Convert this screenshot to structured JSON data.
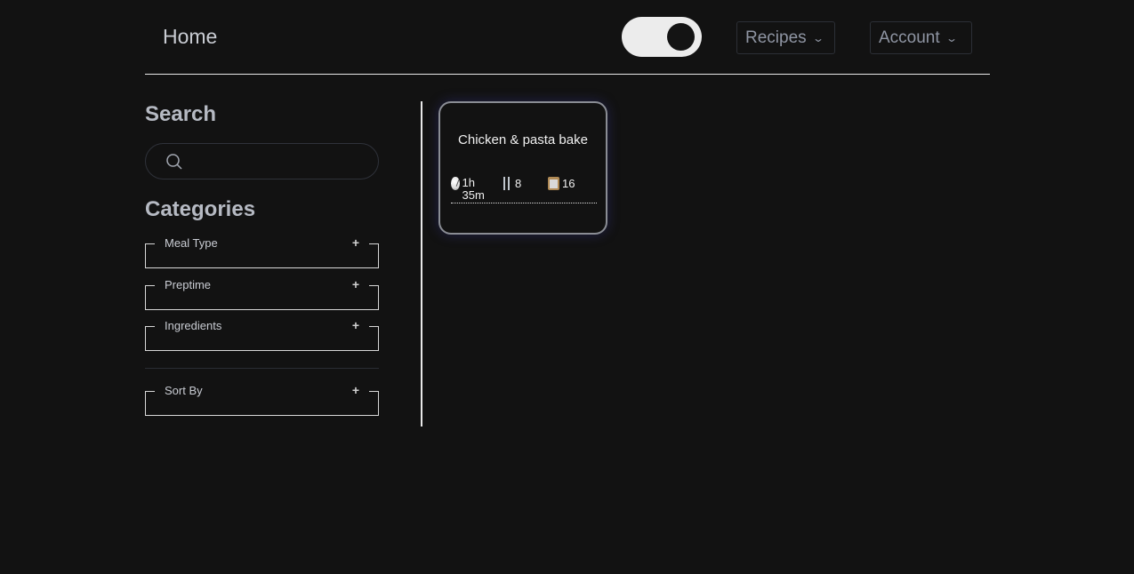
{
  "nav": {
    "brand": "Home",
    "theme_toggle": {
      "state": "on"
    },
    "recipes_label": "Recipes",
    "account_label": "Account"
  },
  "sidebar": {
    "search_heading": "Search",
    "search": {
      "value": "",
      "placeholder": ""
    },
    "categories_heading": "Categories",
    "filters": [
      {
        "label": "Meal Type",
        "toggle": "+"
      },
      {
        "label": "Preptime",
        "toggle": "+"
      },
      {
        "label": "Ingredients",
        "toggle": "+"
      }
    ],
    "sort": {
      "label": "Sort By",
      "toggle": "+"
    }
  },
  "recipes": [
    {
      "title": "Chicken & pasta bake",
      "time": "1h 35m",
      "servings": "8",
      "ingredients": "16",
      "icons": [
        "clock-icon",
        "fork-knife-icon",
        "clipboard-icon"
      ]
    }
  ]
}
